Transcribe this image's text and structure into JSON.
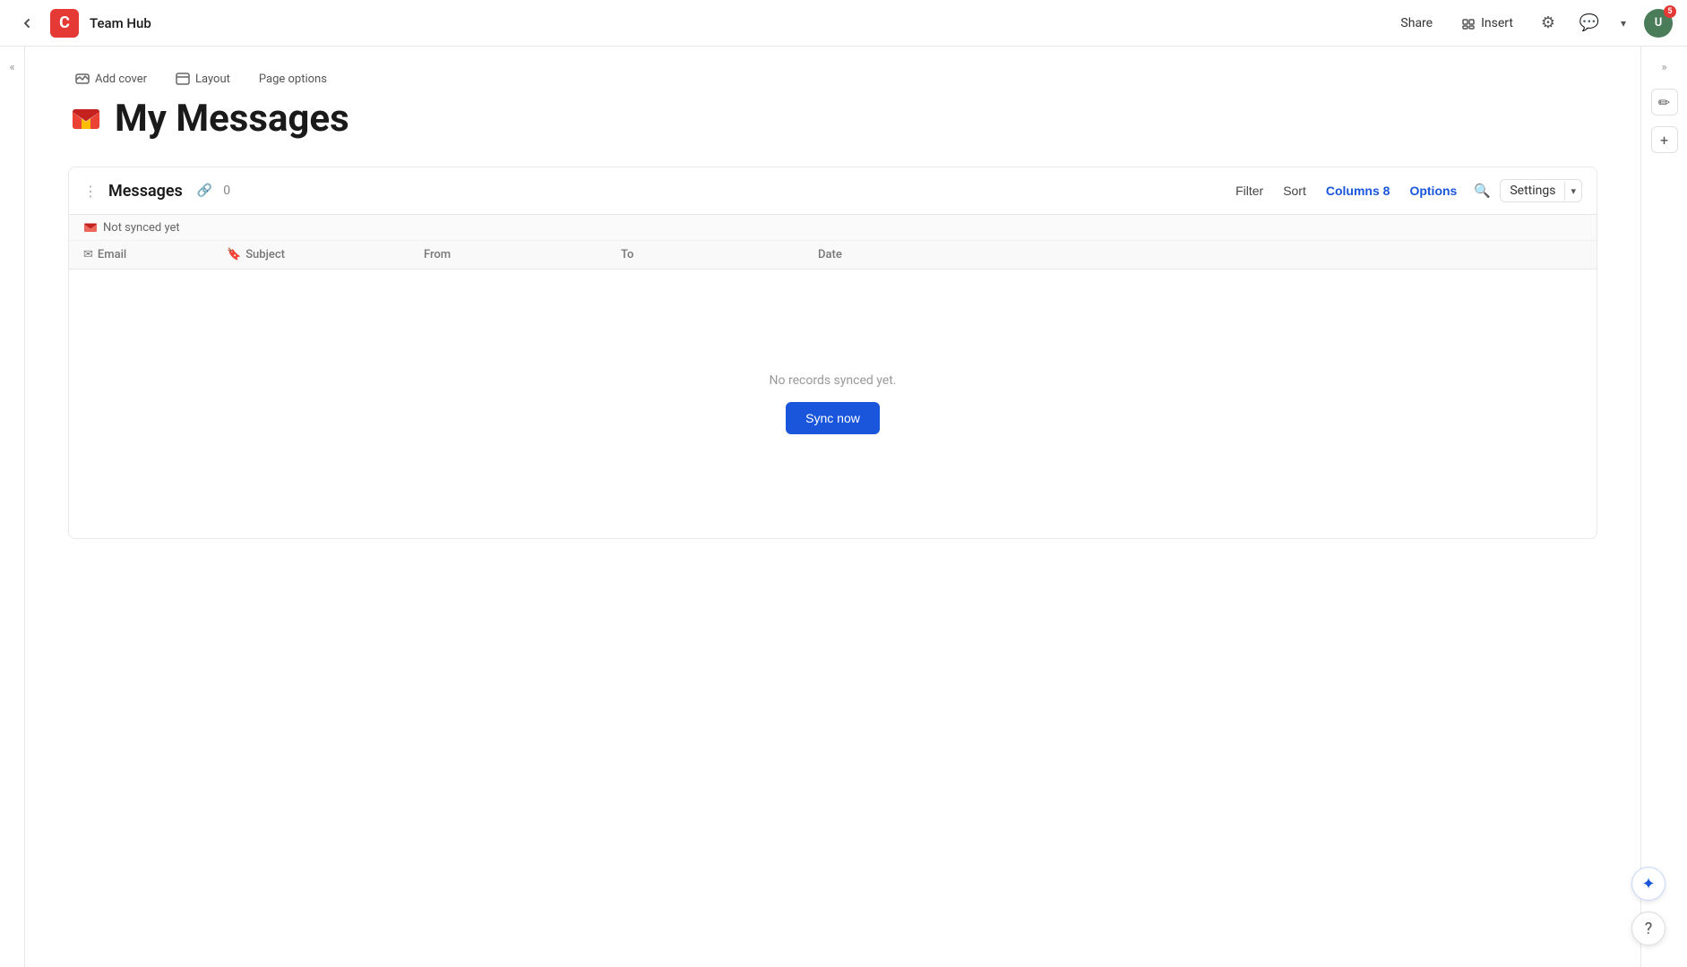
{
  "app": {
    "logo_letter": "C",
    "title": "Team Hub"
  },
  "topbar": {
    "share_label": "Share",
    "insert_label": "Insert",
    "avatar_initials": "U",
    "avatar_badge": "5"
  },
  "page": {
    "add_cover_label": "Add cover",
    "layout_label": "Layout",
    "page_options_label": "Page options",
    "title": "My Messages"
  },
  "messages_block": {
    "title": "Messages",
    "record_count": "0",
    "filter_label": "Filter",
    "sort_label": "Sort",
    "columns_label": "Columns",
    "columns_count": "8",
    "options_label": "Options",
    "settings_label": "Settings",
    "sync_status": "Not synced yet",
    "no_records_text": "No records synced yet.",
    "sync_now_label": "Sync now"
  },
  "table": {
    "columns": [
      {
        "label": "Email",
        "icon": "email"
      },
      {
        "label": "Subject",
        "icon": "bookmark"
      },
      {
        "label": "From",
        "icon": ""
      },
      {
        "label": "To",
        "icon": ""
      },
      {
        "label": "Date",
        "icon": ""
      }
    ]
  },
  "left_panel": {
    "collapse_icon": "«"
  },
  "right_panel": {
    "collapse_icon": "»",
    "edit_icon": "✏",
    "add_icon": "+"
  },
  "floating": {
    "sparkle_label": "✦",
    "help_label": "?"
  }
}
